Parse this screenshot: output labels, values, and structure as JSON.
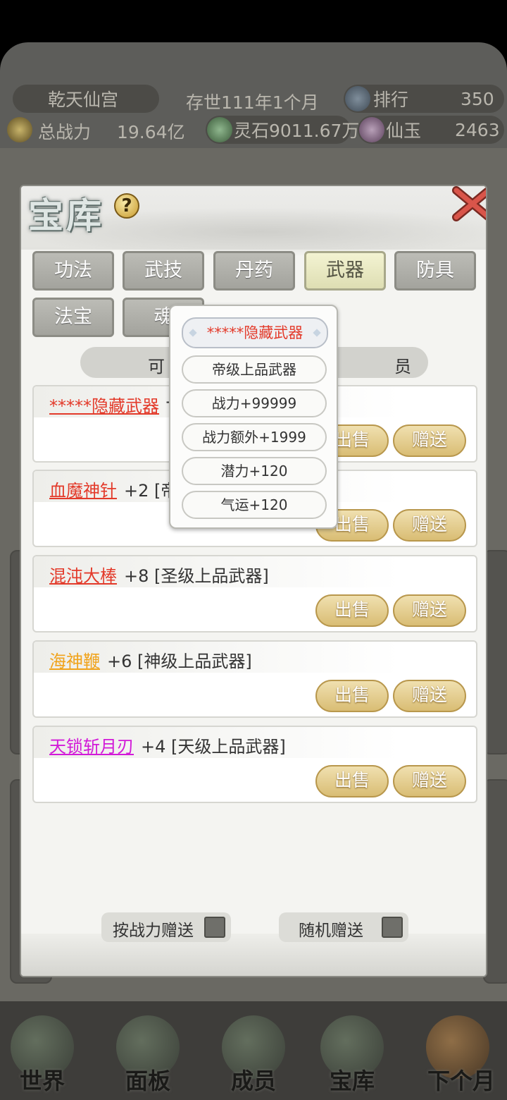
{
  "status": {
    "sect_name": "乾天仙宫",
    "era": "存世111年1个月",
    "rank_label": "排行",
    "rank_value": "350",
    "power_label": "总战力",
    "power_value": "19.64亿",
    "spirit_stone": "灵石9011.67万",
    "jade_label": "仙玉",
    "jade_value": "2463"
  },
  "dialog": {
    "title": "宝库",
    "tabs": [
      {
        "label": "功法",
        "active": false
      },
      {
        "label": "武技",
        "active": false
      },
      {
        "label": "丹药",
        "active": false
      },
      {
        "label": "武器",
        "active": true
      },
      {
        "label": "防具",
        "active": false
      },
      {
        "label": "法宝",
        "active": false
      },
      {
        "label": "魂",
        "active": false
      }
    ],
    "filter_left": "可",
    "filter_right": "员",
    "items": [
      {
        "name": "*****隐藏武器",
        "level": "+",
        "color": "#e33a2a"
      },
      {
        "name": "血魔神针",
        "level": "+2 [帝",
        "color": "#e33a2a"
      },
      {
        "name": "混沌大棒",
        "level": "+8 [圣级上品武器]",
        "color": "#e33a2a"
      },
      {
        "name": "海神鞭",
        "level": "+6 [神级上品武器]",
        "color": "#f0a31c"
      },
      {
        "name": "天锁斩月刃",
        "level": "+4 [天级上品武器]",
        "color": "#d21ad8"
      }
    ],
    "sell_label": "出售",
    "gift_label": "赠送",
    "gift_by_power": "按战力赠送",
    "gift_random": "随机赠送"
  },
  "popup": {
    "rows": [
      "*****隐藏武器",
      "帝级上品武器",
      "战力+99999",
      "战力额外+1999",
      "潜力+120",
      "气运+120"
    ]
  },
  "nav": {
    "items": [
      "世界",
      "面板",
      "成员",
      "宝库",
      "下个月"
    ]
  }
}
